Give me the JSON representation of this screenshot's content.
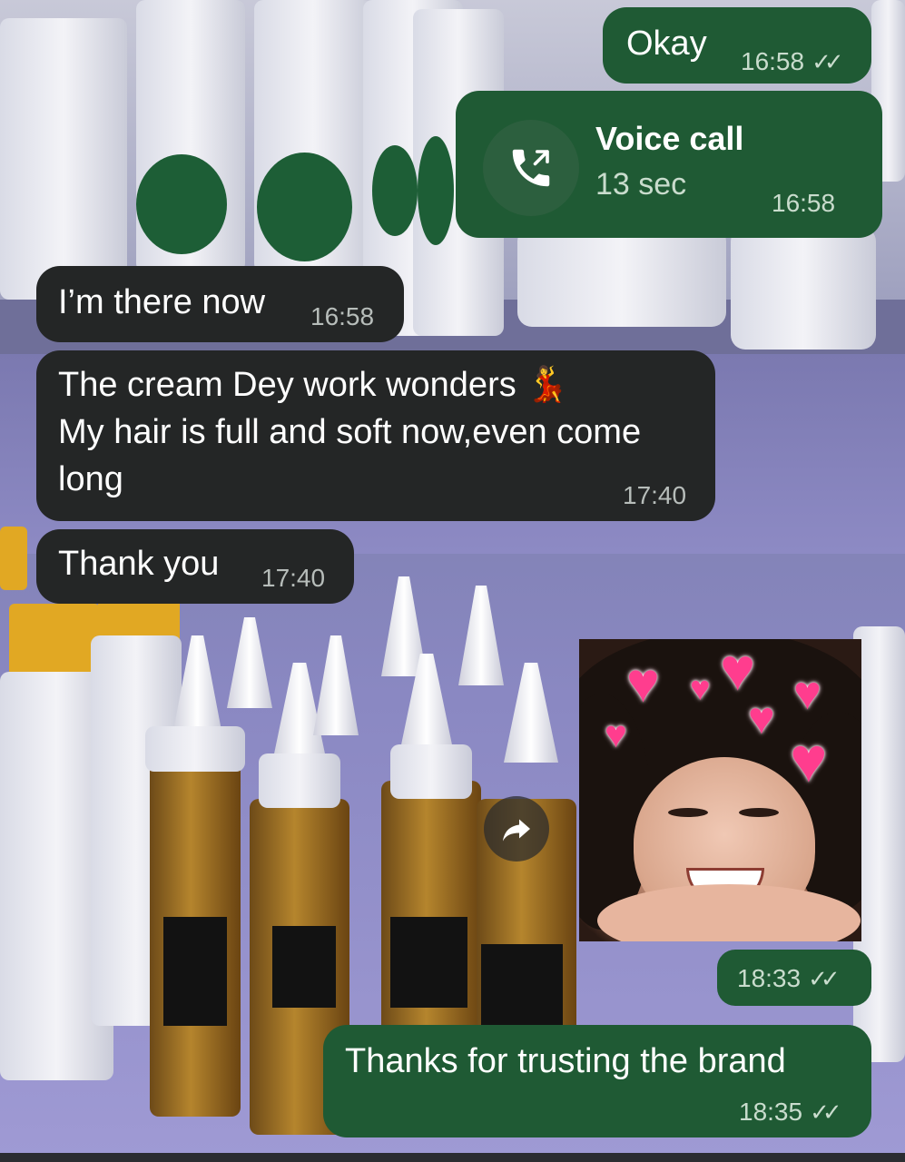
{
  "messages": [
    {
      "id": "m1",
      "direction": "outgoing",
      "text": "Okay",
      "time": "16:58",
      "read": true
    },
    {
      "id": "m2",
      "direction": "outgoing",
      "type": "voice-call",
      "title": "Voice call",
      "duration": "13 sec",
      "time": "16:58"
    },
    {
      "id": "m3",
      "direction": "incoming",
      "text": "I’m there now",
      "time": "16:58"
    },
    {
      "id": "m4",
      "direction": "incoming",
      "text": "The cream Dey work wonders 💃\nMy hair is full and soft now,even come\nlong",
      "time": "17:40"
    },
    {
      "id": "m5",
      "direction": "incoming",
      "text": "Thank you",
      "time": "17:40"
    },
    {
      "id": "m6",
      "direction": "outgoing",
      "type": "image",
      "time": "18:33",
      "read": true
    },
    {
      "id": "m7",
      "direction": "outgoing",
      "text": "Thanks for trusting the brand",
      "time": "18:35",
      "read": true
    }
  ],
  "icons": {
    "call": "outgoing-call-icon",
    "forward": "forward-arrow-icon",
    "read_ticks": "double-check-icon"
  },
  "colors": {
    "incoming_bubble": "#242626",
    "outgoing_bubble": "#1f5a34",
    "heart": "#ff3d8e"
  }
}
